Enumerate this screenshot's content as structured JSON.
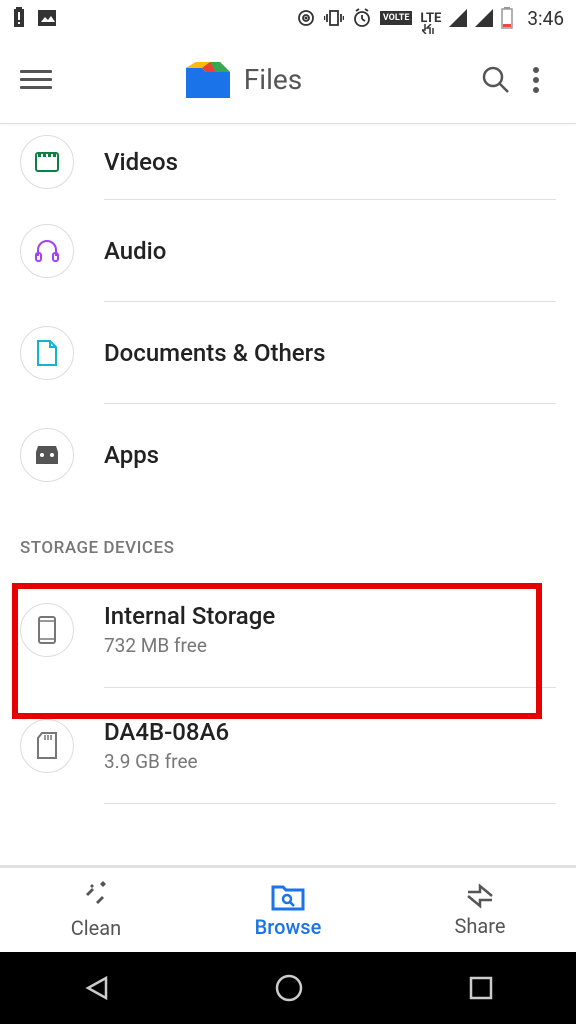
{
  "status": {
    "time": "3:46",
    "volte": "VOLTE",
    "lte": "LTE"
  },
  "app": {
    "title": "Files"
  },
  "categories": [
    {
      "label": "Videos"
    },
    {
      "label": "Audio"
    },
    {
      "label": "Documents & Others"
    },
    {
      "label": "Apps"
    }
  ],
  "section_header": "STORAGE DEVICES",
  "storage": [
    {
      "title": "Internal Storage",
      "subtitle": "732 MB free"
    },
    {
      "title": "DA4B-08A6",
      "subtitle": "3.9 GB free"
    }
  ],
  "nav": {
    "clean": "Clean",
    "browse": "Browse",
    "share": "Share"
  }
}
